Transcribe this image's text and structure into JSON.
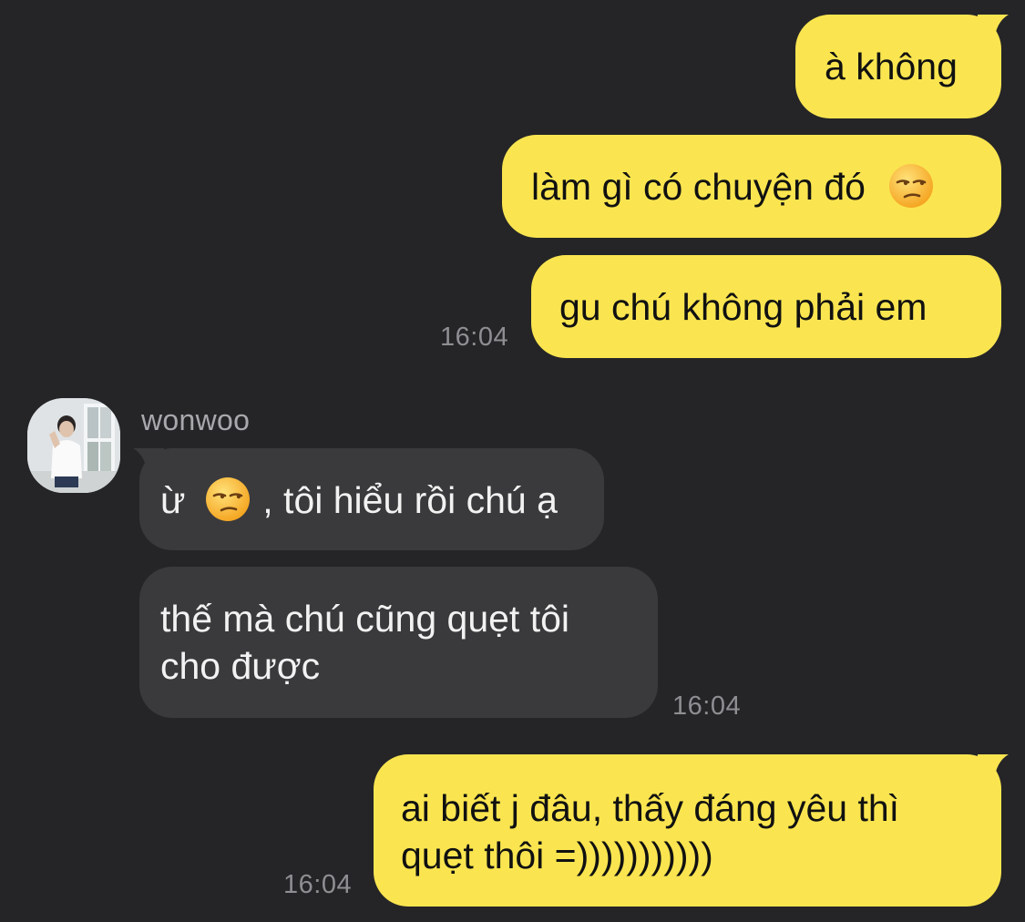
{
  "messages": {
    "m1": {
      "text": "à không"
    },
    "m2": {
      "text": "làm gì có chuyện đó",
      "emoji": "unamused-face"
    },
    "m3": {
      "text": "gu chú không phải em",
      "time": "16:04"
    },
    "m4": {
      "sender": "wonwoo",
      "text_before": "ừ",
      "emoji": "unamused-face",
      "text_after": ", tôi hiểu rồi chú ạ"
    },
    "m5": {
      "line1": "thế mà chú cũng quẹt tôi",
      "line2": "cho được",
      "time": "16:04"
    },
    "m6": {
      "line1": "ai biết j đâu, thấy đáng yêu thì",
      "line2": "quẹt thôi =)))))))))))",
      "time": "16:04"
    }
  },
  "colors": {
    "background": "#252527",
    "outgoing_bubble": "#fae550",
    "incoming_bubble": "#3a3a3c",
    "timestamp": "#8e8e93"
  }
}
